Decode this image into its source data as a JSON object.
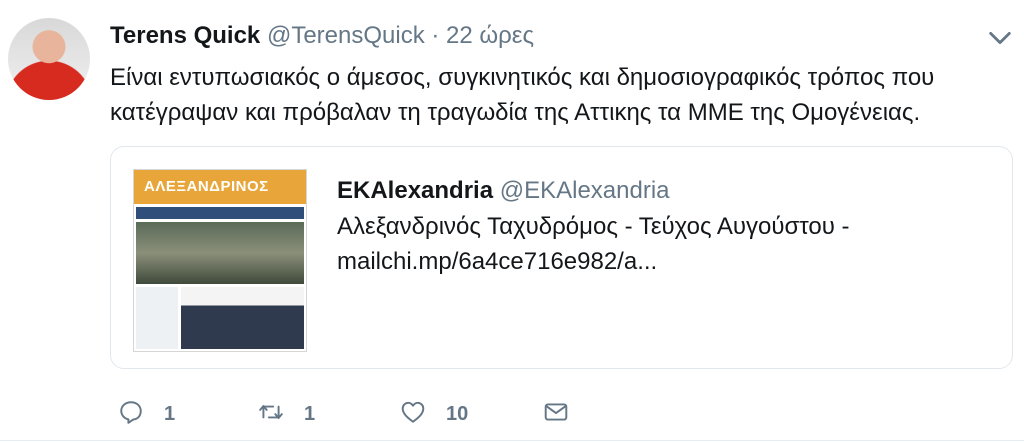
{
  "tweet": {
    "author_name": "Terens Quick",
    "author_handle": "@TerensQuick",
    "separator": "·",
    "time": "22 ώρες",
    "text": "Είναι εντυπωσιακός ο άμεσος, συγκινητικός και δημοσιογραφικός τρόπος που κατέγραψαν και πρόβαλαν τη τραγωδία της Αττικης τα ΜΜΕ της Ομογένειας."
  },
  "card": {
    "author_name": "EKAlexandria",
    "author_handle": "@EKAlexandria",
    "line1": "Αλεξανδρινός Ταχυδρόμος - Τεύχος Αυγούστου -",
    "line2": "mailchi.mp/6a4ce716e982/a...",
    "thumbnail_masthead": "ΑΛΕΞΑΝΔΡΙΝΟΣ"
  },
  "actions": {
    "reply_count": "1",
    "retweet_count": "1",
    "like_count": "10"
  },
  "colors": {
    "text": "#14171a",
    "secondary": "#657786",
    "border": "#e1e8ed"
  },
  "icons": [
    "avatar",
    "chevron-down-icon",
    "reply-icon",
    "retweet-icon",
    "heart-icon",
    "message-icon"
  ]
}
